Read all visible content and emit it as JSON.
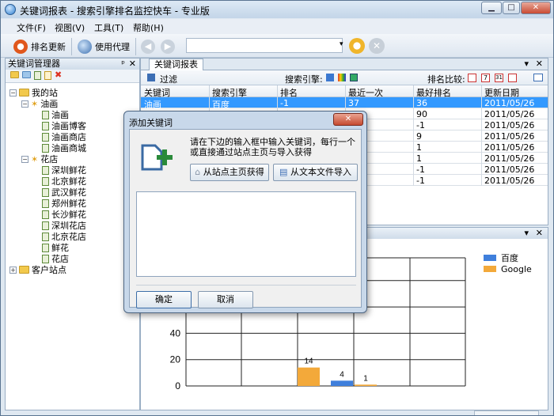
{
  "window": {
    "title": "关键词报表 - 搜索引擎排名监控快车 - 专业版"
  },
  "menu": [
    "文件(F)",
    "视图(V)",
    "工具(T)",
    "帮助(H)"
  ],
  "toolbar": {
    "update_label": "排名更新",
    "proxy_label": "使用代理"
  },
  "tree": {
    "title": "关键词管理器",
    "root": "我的站",
    "group1": "油画",
    "group1_items": [
      "油画",
      "油画博客",
      "油画商店",
      "油画商城"
    ],
    "group2": "花店",
    "group2_items": [
      "深圳鲜花",
      "北京鲜花",
      "武汉鲜花",
      "郑州鲜花",
      "长沙鲜花",
      "深圳花店",
      "北京花店",
      "鲜花",
      "花店"
    ],
    "other": "客户站点"
  },
  "report": {
    "tab": "关键词报表",
    "filter": "过滤",
    "engine_label": "搜索引擎:",
    "compare_label": "排名比较:",
    "columns": [
      "关键词",
      "搜索引擎",
      "排名",
      "最近一次",
      "最好排名",
      "更新日期"
    ],
    "rows": [
      [
        "油画",
        "百度",
        "-1",
        "37",
        "36",
        "2011/05/26"
      ],
      [
        "",
        "",
        "",
        "",
        "90",
        "2011/05/26"
      ],
      [
        "",
        "",
        "",
        "",
        "-1",
        "2011/05/26"
      ],
      [
        "",
        "",
        "",
        "",
        "9",
        "2011/05/26"
      ],
      [
        "",
        "",
        "",
        "",
        "1",
        "2011/05/26"
      ],
      [
        "",
        "",
        "",
        "",
        "1",
        "2011/05/26"
      ],
      [
        "",
        "",
        "",
        "",
        "-1",
        "2011/05/26"
      ],
      [
        "",
        "",
        "",
        "",
        "-1",
        "2011/05/26"
      ]
    ]
  },
  "chart_data": {
    "type": "bar",
    "series": [
      {
        "name": "百度",
        "color": "#3f7fdc"
      },
      {
        "name": "Google",
        "color": "#f3a93a"
      }
    ],
    "ytick_labels": [
      "0",
      "20",
      "40"
    ],
    "bars": [
      {
        "series": "Google",
        "value": 14,
        "label": "14"
      },
      {
        "series": "百度",
        "value": 4,
        "label": "4"
      },
      {
        "series": "Google",
        "value": 1,
        "label": "1"
      }
    ]
  },
  "dialog": {
    "title": "添加关键词",
    "message": "请在下边的输入框中输入关键词，每行一个或直接通过站点主页与导入获得",
    "from_home_label": "从站点主页获得",
    "from_file_label": "从文本文件导入",
    "ok_label": "确定",
    "cancel_label": "取消"
  },
  "colors": {
    "selection": "#3399ff",
    "accent": "#2a8a3a"
  }
}
